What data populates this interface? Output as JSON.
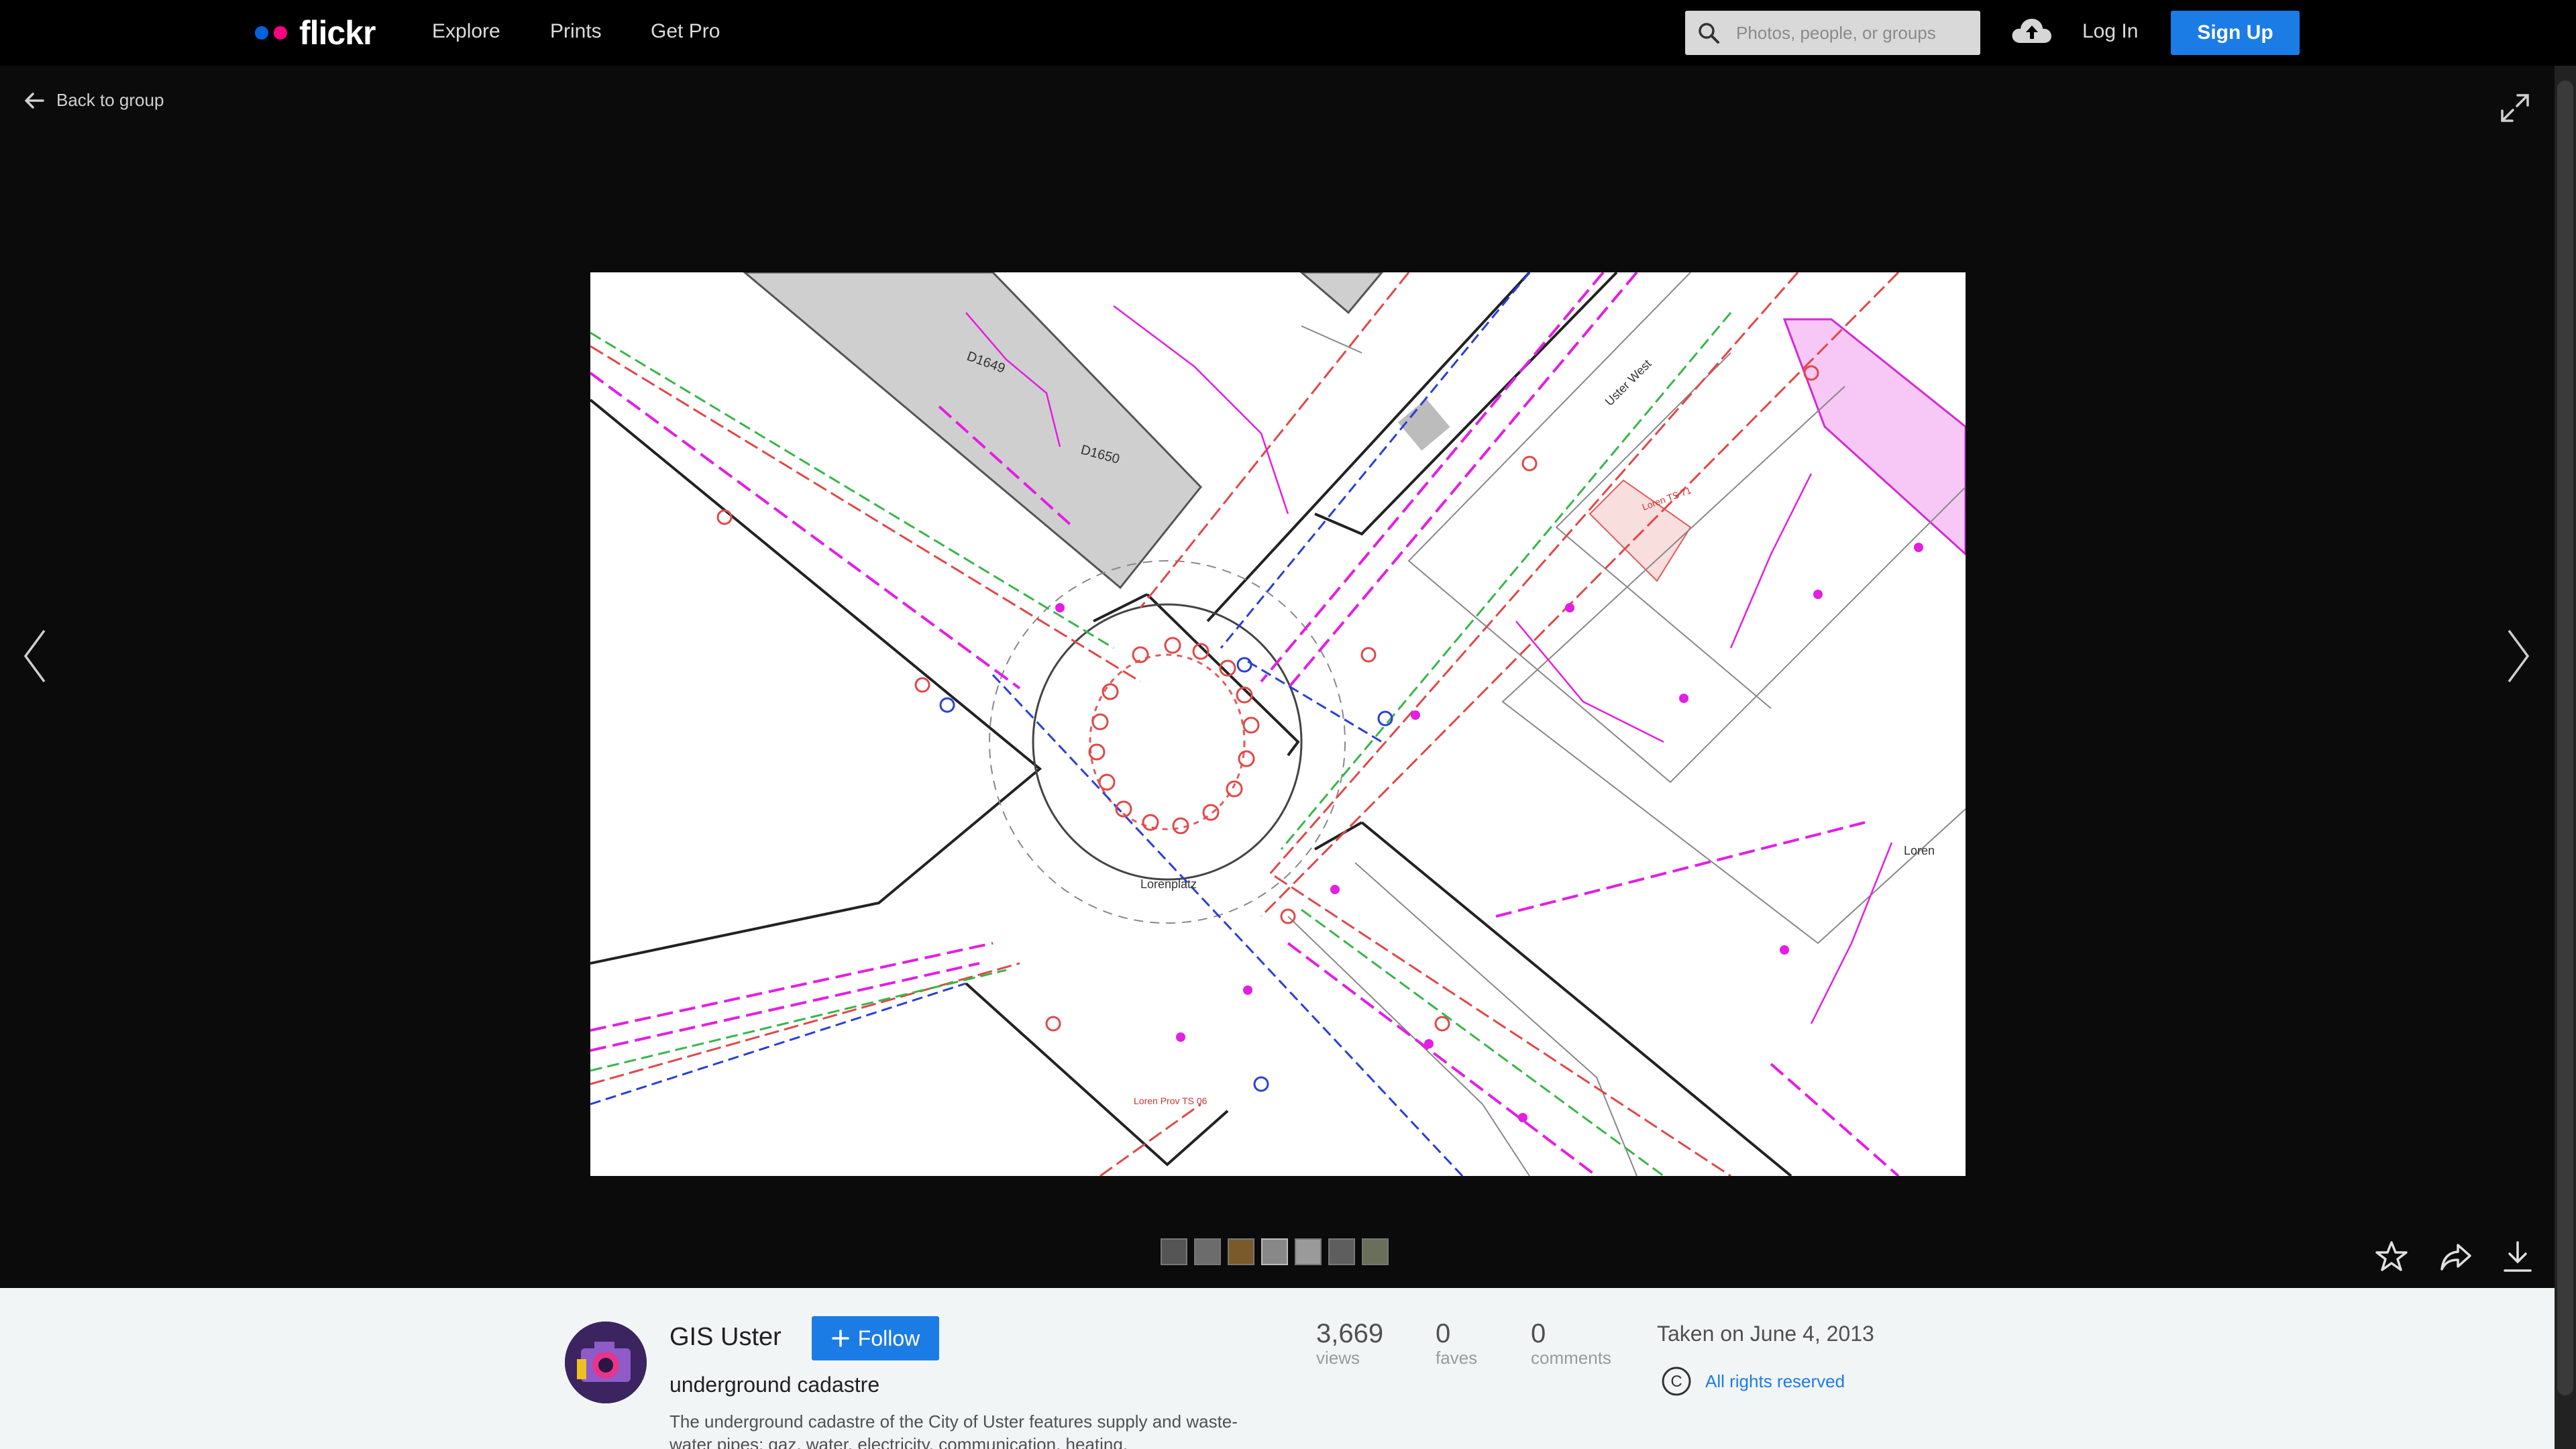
{
  "nav": {
    "brand": "flickr",
    "brand_colors": [
      "#0063dc",
      "#ff0084"
    ],
    "links": [
      "Explore",
      "Prints",
      "Get Pro"
    ],
    "search_placeholder": "Photos, people, or groups",
    "login": "Log In",
    "signup": "Sign Up",
    "accent": "#1c7ce5"
  },
  "viewer": {
    "back_label": "Back to group",
    "map_labels": {
      "d1649": "D1649",
      "d1650": "D1650",
      "lorenplatz": "Lorenplatz",
      "loren": "Loren",
      "uster_west": "Uster West",
      "loren_ts": "Loren TS 71",
      "loren_prov": "Loren Prov TS 06"
    },
    "thumbnail_count": 7,
    "icons": [
      "back-arrow-icon",
      "expand-icon",
      "chevron-left-icon",
      "chevron-right-icon",
      "star-icon",
      "share-icon",
      "download-icon"
    ]
  },
  "owner": {
    "name": "GIS Uster",
    "follow_label": "Follow"
  },
  "photo": {
    "title": "underground cadastre",
    "description": "The underground cadastre of the City of Uster features supply and waste-water pipes: gaz, water, electricity, communication, heating,"
  },
  "stats": [
    {
      "num": "3,669",
      "label": "views"
    },
    {
      "num": "0",
      "label": "faves"
    },
    {
      "num": "0",
      "label": "comments"
    }
  ],
  "meta": {
    "taken": "Taken on June 4, 2013",
    "license": "All rights reserved",
    "license_symbol": "C"
  }
}
